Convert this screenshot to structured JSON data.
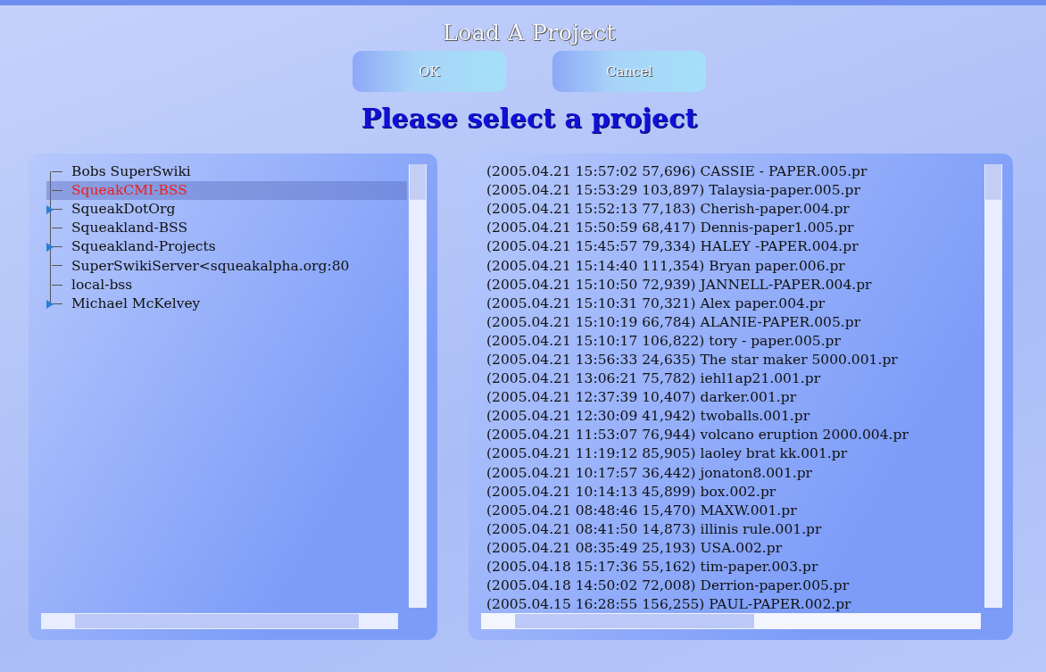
{
  "dialog": {
    "title": "Load A Project",
    "buttons": [
      "OK",
      "Cancel"
    ],
    "prompt": "Please select a project"
  },
  "servers": [
    {
      "label": "Bobs SuperSwiki",
      "collapsed": false,
      "selected": false
    },
    {
      "label": "SqueakCMI-BSS",
      "collapsed": false,
      "selected": true
    },
    {
      "label": "SqueakDotOrg",
      "collapsed": true,
      "selected": false
    },
    {
      "label": "Squeakland-BSS",
      "collapsed": false,
      "selected": false
    },
    {
      "label": "Squeakland-Projects",
      "collapsed": true,
      "selected": false
    },
    {
      "label": "SuperSwikiServer<squeakalpha.org:80",
      "collapsed": false,
      "selected": false
    },
    {
      "label": "local-bss",
      "collapsed": false,
      "selected": false
    },
    {
      "label": "Michael McKelvey",
      "collapsed": true,
      "selected": false
    }
  ],
  "projects": [
    "(2005.04.21 15:57:02 57,696) CASSIE - PAPER.005.pr",
    "(2005.04.21 15:53:29 103,897) Talaysia-paper.005.pr",
    "(2005.04.21 15:52:13 77,183) Cherish-paper.004.pr",
    "(2005.04.21 15:50:59 68,417) Dennis-paper1.005.pr",
    "(2005.04.21 15:45:57 79,334) HALEY -PAPER.004.pr",
    "(2005.04.21 15:14:40 111,354) Bryan paper.006.pr",
    "(2005.04.21 15:10:50 72,939) JANNELL-PAPER.004.pr",
    "(2005.04.21 15:10:31 70,321) Alex paper.004.pr",
    "(2005.04.21 15:10:19 66,784) ALANIE-PAPER.005.pr",
    "(2005.04.21 15:10:17 106,822) tory - paper.005.pr",
    "(2005.04.21 13:56:33 24,635) The star maker 5000.001.pr",
    "(2005.04.21 13:06:21 75,782) iehl1ap21.001.pr",
    "(2005.04.21 12:37:39 10,407) darker.001.pr",
    "(2005.04.21 12:30:09 41,942) twoballs.001.pr",
    "(2005.04.21 11:53:07 76,944) volcano eruption 2000.004.pr",
    "(2005.04.21 11:19:12 85,905) laoley brat kk.001.pr",
    "(2005.04.21 10:17:57 36,442) jonaton8.001.pr",
    "(2005.04.21 10:14:13 45,899) box.002.pr",
    "(2005.04.21 08:48:46 15,470) MAXW.001.pr",
    "(2005.04.21 08:41:50 14,873) illinis rule.001.pr",
    "(2005.04.21 08:35:49 25,193) USA.002.pr",
    "(2005.04.18 15:17:36 55,162) tim-paper.003.pr",
    "(2005.04.18 14:50:02 72,008) Derrion-paper.005.pr",
    "(2005.04.15 16:28:55 156,255) PAUL-PAPER.002.pr"
  ]
}
